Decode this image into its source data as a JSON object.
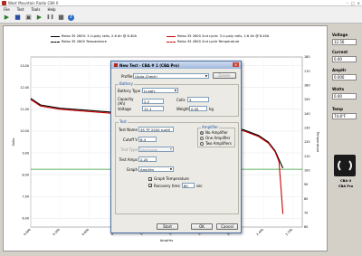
{
  "window": {
    "title": "West Mountain Radio CBA II"
  },
  "menu": [
    "File",
    "Test",
    "Tools",
    "Help"
  ],
  "toolbar": [
    {
      "name": "open-icon",
      "glyph": "▶"
    },
    {
      "name": "save-icon",
      "glyph": "■"
    },
    {
      "name": "new-icon",
      "glyph": "▣"
    },
    {
      "name": "play-icon",
      "glyph": "▶"
    },
    {
      "name": "pause-icon",
      "glyph": "❚❚"
    },
    {
      "name": "stop-icon",
      "glyph": "■"
    },
    {
      "name": "help-icon",
      "glyph": "?"
    }
  ],
  "legend": [
    {
      "label": "Relax 35 2600: 3 Li-poly cells, 2.6 Ah @ 8.40A",
      "color": "#000000",
      "dashed": false
    },
    {
      "label": "Relax 35 2600 Temperature",
      "color": "#000000",
      "dashed": true
    },
    {
      "label": "Relax 35 2600 2nd cycle: 3 Li-poly cells, 2.6 Ah @ 8.40A",
      "color": "#cc0000",
      "dashed": false
    },
    {
      "label": "Relax 35 2600 2nd cycle Temperature",
      "color": "#cc0000",
      "dashed": true
    }
  ],
  "chart_data": {
    "type": "line",
    "xlabel": "AmpHrs",
    "ylabel": "Volts",
    "y2label": "Temperature",
    "xticks": [
      "0.000",
      "0.300",
      "0.600",
      "0.900",
      "1.200",
      "1.500",
      "1.800",
      "2.100",
      "2.400",
      "2.700"
    ],
    "yticks": [
      "13.00",
      "12.00",
      "11.00",
      "10.00",
      "9.00",
      "8.00",
      "7.00",
      "6.00"
    ],
    "y2ticks": [
      "180",
      "170",
      "160",
      "150",
      "140",
      "130",
      "120",
      "110",
      "100",
      "90",
      "80",
      "70",
      "60"
    ],
    "xlim": [
      0,
      2.8
    ],
    "ylim": [
      5.6,
      13.4
    ],
    "cutoff_line": 8.25,
    "series": [
      {
        "name": "Relax 35 2600: 3 Li-poly cells, 2.6 Ah @ 8.40A",
        "color": "#000000",
        "x": [
          0.0,
          0.1,
          0.3,
          0.6,
          0.9,
          1.2,
          1.5,
          1.8,
          2.0,
          2.2,
          2.35,
          2.45,
          2.52,
          2.56,
          2.6
        ],
        "y": [
          11.5,
          11.2,
          11.05,
          10.95,
          10.85,
          10.75,
          10.6,
          10.4,
          10.25,
          10.05,
          9.8,
          9.5,
          9.1,
          8.7,
          8.3
        ]
      },
      {
        "name": "Relax 35 2600 2nd cycle: 3 Li-poly cells, 2.6 Ah @ 8.40A",
        "color": "#cc0000",
        "x": [
          0.0,
          0.1,
          0.3,
          0.6,
          0.9,
          1.2,
          1.5,
          1.8,
          2.0,
          2.2,
          2.35,
          2.45,
          2.52,
          2.56,
          2.6
        ],
        "y": [
          11.45,
          11.15,
          11.0,
          10.9,
          10.8,
          10.7,
          10.55,
          10.35,
          10.2,
          10.0,
          9.75,
          9.45,
          9.05,
          8.6,
          6.2
        ]
      }
    ]
  },
  "side": {
    "voltage_label": "Voltage",
    "voltage": "12.56",
    "current_label": "Current",
    "current": "0.00",
    "amphr_label": "AmpHr",
    "amphr": "0.000",
    "watts_label": "Watts",
    "watts": "0.00",
    "temp_label": "Temp",
    "temp": "74.8°F",
    "device_id": "CBA II",
    "device_model": "CBA Pro"
  },
  "dialog": {
    "title": "New Test - CBA # 1 (CBA Pro)",
    "profile_label": "Profile",
    "profile_value": "(Auto-Check)",
    "delete_label": "Delete",
    "battery_group": "Battery",
    "battery_type_label": "Battery Type",
    "battery_type_value": "Li-poly",
    "capacity_label": "Capacity (Ah)",
    "capacity_value": "2.2",
    "cells_label": "Cells",
    "cells_value": "3",
    "voltage_label": "Voltage",
    "voltage_value": "11.1",
    "weight_label": "Weight",
    "weight_value": "0.05",
    "weight_unit": "kg",
    "test_group": "Test",
    "test_name_label": "Test Name",
    "test_name_value": "3S TP 2200 ruxHI",
    "cutoff_label": "Cutoff V",
    "cutoff_value": "8.4",
    "test_type_label": "Test Type",
    "test_type_value": "Discharge",
    "test_amps_label": "Test Amps",
    "test_amps_value": "2.20",
    "graph_label": "Graph",
    "graph_value": "AmpHrs",
    "amplifier_group": "Amplifier",
    "amp_options": [
      "No Amplifier",
      "One Amplifier",
      "Two Amplifiers"
    ],
    "graph_temp_label": "Graph Temperature",
    "recovery_label": "Recovery time",
    "recovery_value": "60",
    "recovery_unit": "sec",
    "start_label": "Start",
    "ok_label": "OK",
    "cancel_label": "Cancel"
  }
}
